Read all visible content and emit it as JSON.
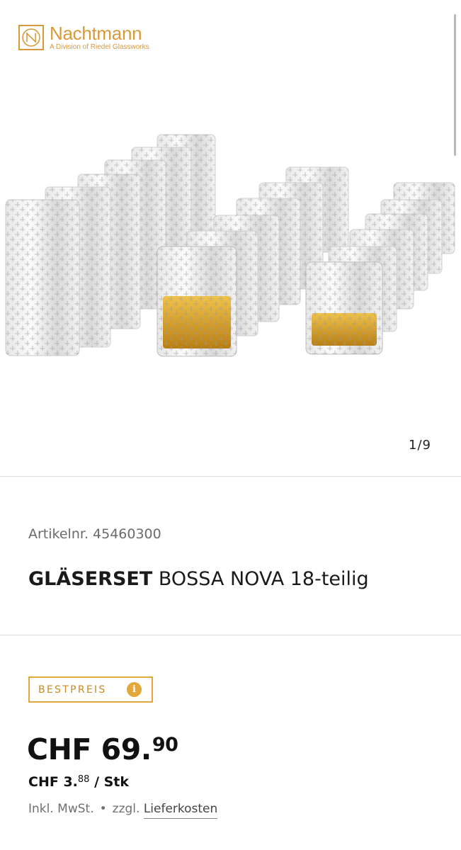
{
  "brand": {
    "name": "Nachtmann",
    "subtitle": "A Division of Riedel Glassworks",
    "color": "#d79a3a"
  },
  "gallery": {
    "counter": "1/9"
  },
  "product": {
    "article_number": "Artikelnr. 45460300",
    "title_bold": "GLÄSERSET",
    "title_rest": "BOSSA NOVA 18-teilig"
  },
  "pricing": {
    "badge": "BESTPREIS",
    "badge_icon": "i",
    "price_main": "CHF 69.",
    "price_cents": "90",
    "unit_main": "CHF 3.",
    "unit_cents": "88",
    "unit_suffix": "/ Stk",
    "tax_text": "Inkl. MwSt.",
    "separator": "•",
    "shipping_prefix": "zzgl.",
    "shipping_link": "Lieferkosten",
    "accent_color": "#e2a83a"
  }
}
